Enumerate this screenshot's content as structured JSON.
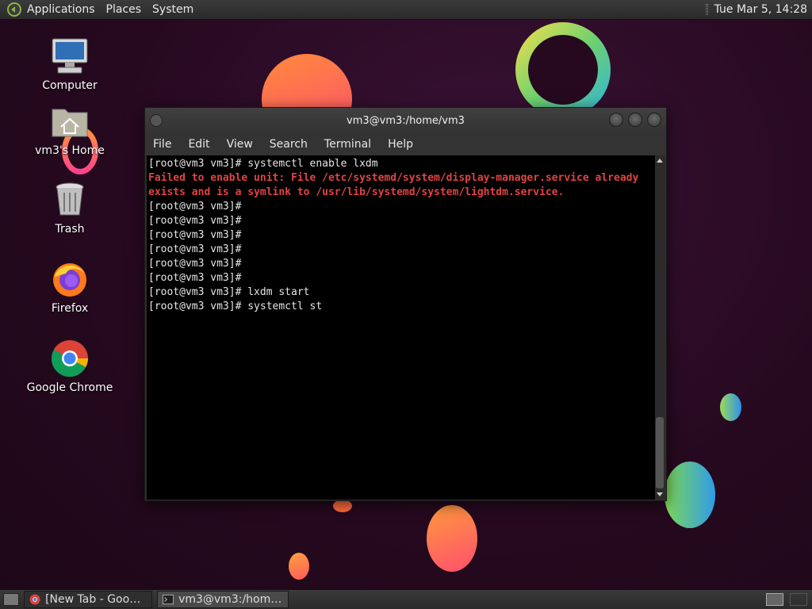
{
  "top_panel": {
    "menus": [
      "Applications",
      "Places",
      "System"
    ],
    "clock": "Tue Mar  5, 14:28"
  },
  "desktop_icons": [
    {
      "label": "Computer",
      "icon": "computer-icon"
    },
    {
      "label": "vm3's Home",
      "icon": "home-folder-icon"
    },
    {
      "label": "Trash",
      "icon": "trash-icon"
    },
    {
      "label": "Firefox",
      "icon": "firefox-icon"
    },
    {
      "label": "Google Chrome",
      "icon": "chrome-icon"
    }
  ],
  "terminal": {
    "title": "vm3@vm3:/home/vm3",
    "menu": [
      "File",
      "Edit",
      "View",
      "Search",
      "Terminal",
      "Help"
    ],
    "lines": [
      {
        "text": "[root@vm3 vm3]# systemctl enable lxdm",
        "error": false
      },
      {
        "text": "Failed to enable unit: File /etc/systemd/system/display-manager.service already",
        "error": true
      },
      {
        "text": "exists and is a symlink to /usr/lib/systemd/system/lightdm.service.",
        "error": true
      },
      {
        "text": "[root@vm3 vm3]#",
        "error": false
      },
      {
        "text": "[root@vm3 vm3]#",
        "error": false
      },
      {
        "text": "[root@vm3 vm3]#",
        "error": false
      },
      {
        "text": "[root@vm3 vm3]#",
        "error": false
      },
      {
        "text": "[root@vm3 vm3]#",
        "error": false
      },
      {
        "text": "[root@vm3 vm3]#",
        "error": false
      },
      {
        "text": "[root@vm3 vm3]# lxdm start",
        "error": false
      },
      {
        "text": "[root@vm3 vm3]# systemctl st",
        "error": false
      }
    ]
  },
  "taskbar": {
    "tasks": [
      {
        "label": "[New Tab - Google ...",
        "icon": "chrome-icon",
        "active": false
      },
      {
        "label": "vm3@vm3:/home/v...",
        "icon": "terminal-icon",
        "active": true
      }
    ]
  },
  "colors": {
    "error_text": "#e24343",
    "terminal_bg": "#000000"
  }
}
